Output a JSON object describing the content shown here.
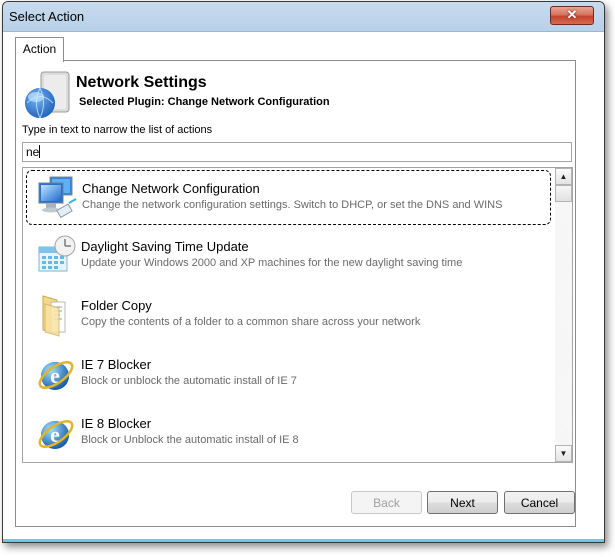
{
  "window": {
    "title": "Select Action",
    "close_label": "✕"
  },
  "tabs": [
    {
      "label": "Action",
      "active": true
    }
  ],
  "header": {
    "icon": "network-settings-icon",
    "title": "Network Settings",
    "subtitle": "Selected Plugin: Change Network Configuration"
  },
  "filter": {
    "label": "Type in text to narrow the list of actions",
    "value": "ne"
  },
  "actions": [
    {
      "title": "Change Network Configuration",
      "description": "Change the network configuration settings. Switch to DHCP, or set the DNS and WINS",
      "icon": "network-computers-icon",
      "selected": true
    },
    {
      "title": "Daylight Saving Time Update",
      "description": "Update your Windows 2000 and XP machines for the new daylight saving time",
      "icon": "calendar-clock-icon",
      "selected": false
    },
    {
      "title": "Folder Copy",
      "description": "Copy the contents of a folder to a common share across your network",
      "icon": "folder-icon",
      "selected": false
    },
    {
      "title": "IE 7 Blocker",
      "description": "Block or unblock the automatic install of IE 7",
      "icon": "internet-explorer-icon",
      "selected": false
    },
    {
      "title": "IE 8 Blocker",
      "description": "Block or Unblock the automatic install of IE 8",
      "icon": "internet-explorer-icon",
      "selected": false
    }
  ],
  "scrollbar": {
    "up": "▲",
    "down": "▼"
  },
  "buttons": {
    "back": "Back",
    "next": "Next",
    "cancel": "Cancel",
    "back_enabled": false
  }
}
